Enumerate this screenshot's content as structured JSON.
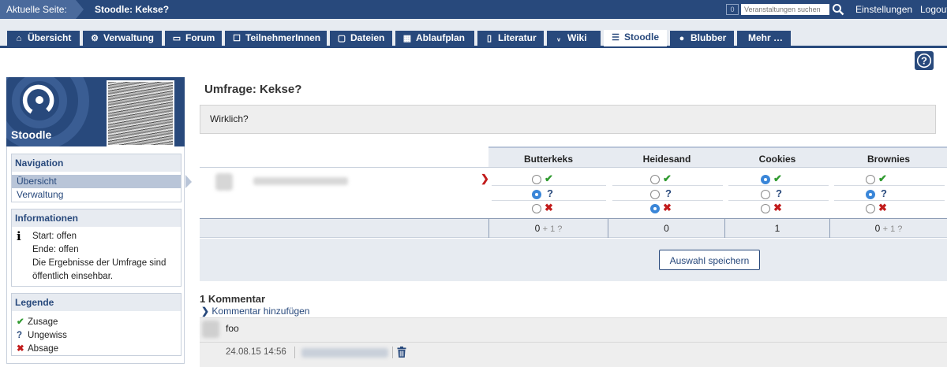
{
  "topbar": {
    "crumb_label": "Aktuelle Seite:",
    "current_page": "Stoodle: Kekse?",
    "counter": "0",
    "search_placeholder": "Veranstaltungen suchen",
    "settings": "Einstellungen",
    "logout": "Logout"
  },
  "tabs": [
    {
      "label": "Übersicht",
      "icon": "home-icon"
    },
    {
      "label": "Verwaltung",
      "icon": "gears-icon"
    },
    {
      "label": "Forum",
      "icon": "forum-icon"
    },
    {
      "label": "TeilnehmerInnen",
      "icon": "persons-icon"
    },
    {
      "label": "Dateien",
      "icon": "files-icon"
    },
    {
      "label": "Ablaufplan",
      "icon": "calendar-icon"
    },
    {
      "label": "Literatur",
      "icon": "literature-icon"
    },
    {
      "label": "Wiki",
      "icon": "wiki-icon"
    },
    {
      "label": "Stoodle",
      "icon": "list-icon"
    },
    {
      "label": "Blubber",
      "icon": "blubber-icon"
    },
    {
      "label": "Mehr …",
      "icon": ""
    }
  ],
  "sidebar": {
    "title": "Stoodle",
    "navigation": {
      "heading": "Navigation",
      "items": [
        "Übersicht",
        "Verwaltung"
      ]
    },
    "info": {
      "heading": "Informationen",
      "start": "Start: offen",
      "end": "Ende: offen",
      "note": "Die Ergebnisse der Umfrage sind öffentlich einsehbar."
    },
    "legend": {
      "heading": "Legende",
      "yes": "Zusage",
      "maybe": "Ungewiss",
      "no": "Absage"
    }
  },
  "poll": {
    "title": "Umfrage: Kekse?",
    "description": "Wirklich?",
    "options": [
      {
        "name": "Butterkeks",
        "selected": "maybe",
        "total": "0",
        "maybe_extra": "+ 1 ?"
      },
      {
        "name": "Heidesand",
        "selected": "no",
        "total": "0",
        "maybe_extra": ""
      },
      {
        "name": "Cookies",
        "selected": "yes",
        "total": "1",
        "maybe_extra": ""
      },
      {
        "name": "Brownies",
        "selected": "maybe",
        "total": "0",
        "maybe_extra": "+ 1 ?"
      }
    ],
    "save_label": "Auswahl speichern"
  },
  "comments": {
    "heading": "1 Kommentar",
    "add_label": "Kommentar hinzufügen",
    "items": [
      {
        "text": "foo",
        "date": "24.08.15 14:56"
      }
    ]
  },
  "colors": {
    "brand": "#28497c",
    "yes": "#2f9a2f",
    "no": "#c21c1c",
    "radio_selected": "#3a86d8"
  }
}
